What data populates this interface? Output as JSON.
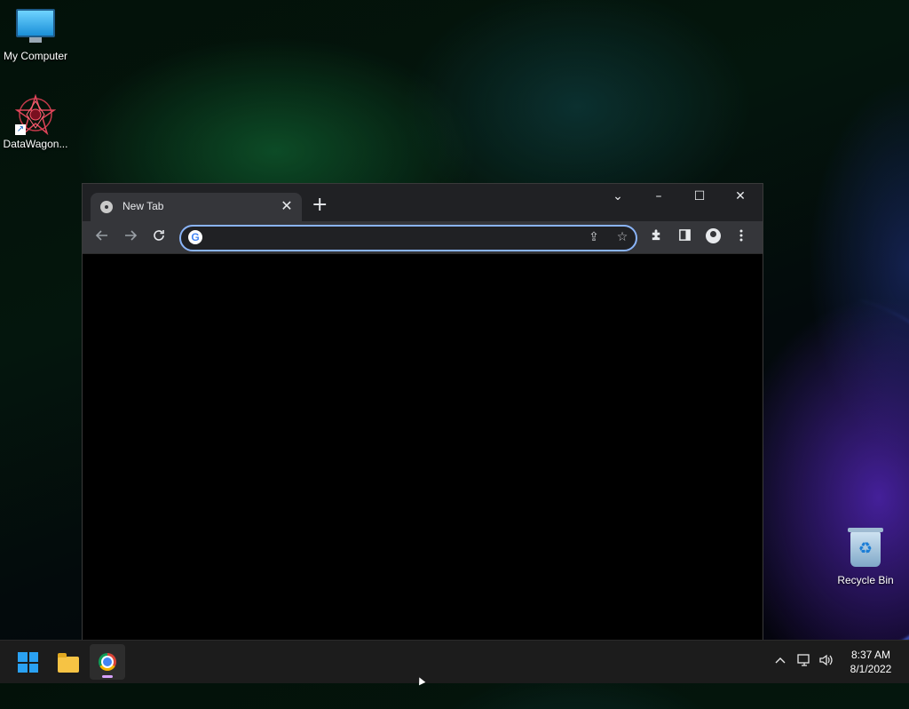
{
  "desktop": {
    "icons": [
      {
        "label": "My Computer",
        "icon": "monitor-icon"
      },
      {
        "label": "DataWagon...",
        "icon": "star-shortcut-icon"
      },
      {
        "label": "Recycle Bin",
        "icon": "recycle-bin-icon"
      }
    ]
  },
  "browser": {
    "tab_title": "New Tab",
    "tab_close": "✕",
    "new_tab": "+",
    "omnibox_value": "",
    "omnibox_focus_color": "#8ab4f8",
    "window_controls": {
      "tab_search": "⌄",
      "minimize": "–",
      "maximize": "☐",
      "close": "✕"
    }
  },
  "taskbar": {
    "apps": [
      "Start",
      "File Explorer",
      "Google Chrome"
    ],
    "active_app": "Google Chrome",
    "clock": {
      "time": "8:37 AM",
      "date": "8/1/2022"
    }
  },
  "colors": {
    "tab_active": "#35363a",
    "titlebar": "#202124",
    "accent_start": "#2aa1f2"
  }
}
